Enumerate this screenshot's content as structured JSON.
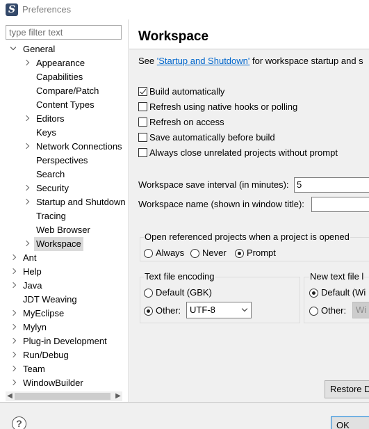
{
  "window": {
    "title": "Preferences"
  },
  "filter": {
    "placeholder": "type filter text"
  },
  "tree": {
    "general": "General",
    "general_children": [
      "Appearance",
      "Capabilities",
      "Compare/Patch",
      "Content Types",
      "Editors",
      "Keys",
      "Network Connections",
      "Perspectives",
      "Search",
      "Security",
      "Startup and Shutdown",
      "Tracing",
      "Web Browser",
      "Workspace"
    ],
    "roots": [
      "Ant",
      "Help",
      "Java",
      "JDT Weaving",
      "MyEclipse",
      "Mylyn",
      "Plug-in Development",
      "Run/Debug",
      "Team",
      "WindowBuilder"
    ]
  },
  "page": {
    "title": "Workspace",
    "intro_prefix": "See ",
    "intro_link": "'Startup and Shutdown'",
    "intro_suffix": " for workspace startup and s",
    "checkboxes": [
      {
        "label": "Build automatically",
        "checked": true
      },
      {
        "label": "Refresh using native hooks or polling",
        "checked": false
      },
      {
        "label": "Refresh on access",
        "checked": false
      },
      {
        "label": "Save automatically before build",
        "checked": false
      },
      {
        "label": "Always close unrelated projects without prompt",
        "checked": false
      }
    ],
    "save_interval_label": "Workspace save interval (in minutes):",
    "save_interval_value": "5",
    "workspace_name_label": "Workspace name (shown in window title):",
    "workspace_name_value": "",
    "open_ref_group": {
      "title": "Open referenced projects when a project is opened",
      "options": [
        "Always",
        "Never",
        "Prompt"
      ],
      "selected": "Prompt"
    },
    "encoding_group": {
      "title": "Text file encoding",
      "default_label": "Default (GBK)",
      "other_label": "Other:",
      "other_value": "UTF-8",
      "selected": "Other"
    },
    "newline_group": {
      "title": "New text file l",
      "default_label": "Default (Wi",
      "other_label": "Other:",
      "other_value": "Wi",
      "selected": "Default"
    },
    "restore_button": "Restore D"
  },
  "footer": {
    "ok_button": "OK"
  }
}
